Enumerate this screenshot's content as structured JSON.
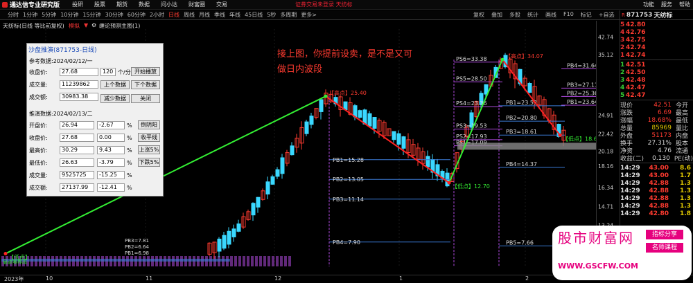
{
  "app": {
    "title": "通达信专业研究版",
    "menu": [
      "投研",
      "股票",
      "期货",
      "数据",
      "问小达",
      "财富圈",
      "交易"
    ],
    "login_notice": "证券交易未登录",
    "login_extra": "天纺标",
    "right_menu": [
      "功能",
      "服务",
      "帮助"
    ],
    "brand_color": "#d22222"
  },
  "period_bar": {
    "periods": [
      "分时",
      "1分钟",
      "5分钟",
      "10分钟",
      "15分钟",
      "30分钟",
      "60分钟",
      "2小时",
      "日线",
      "周线",
      "月线",
      "季线",
      "年线",
      "45日线",
      "5秒",
      "多周期",
      "更多>"
    ],
    "active": "日线",
    "tools": [
      "复权",
      "叠加",
      "多股",
      "统计",
      "画线",
      "F10",
      "标记",
      "+自选",
      "返回"
    ]
  },
  "indicator": {
    "title": "天纺标(日线 等比前复权)",
    "mode": "模拟",
    "formula": "缠论预测主图(1)"
  },
  "dialog": {
    "title": "沙盘推演(871753-日线)",
    "ref_section": "参考数据:2024/02/12/一",
    "ref": [
      {
        "label": "收盘价:",
        "value": "27.68"
      },
      {
        "label": "成交量:",
        "value": "11239862"
      },
      {
        "label": "成交额:",
        "value": "30983.38"
      }
    ],
    "minutes_value": "120",
    "minutes_unit": "个/分",
    "buttons": {
      "start": "开始播放",
      "prev": "上个数据",
      "next": "下个数据",
      "reduce": "减少数据",
      "close": "关闭"
    },
    "push_section": "推演数据:2024/02/13/二",
    "push": [
      {
        "label": "开盘价:",
        "value": "26.94",
        "pct": "-2.67",
        "btn": "倒阴阳"
      },
      {
        "label": "收盘价:",
        "value": "27.68",
        "pct": "0.00",
        "btn": "收平线"
      },
      {
        "label": "最高价:",
        "value": "30.29",
        "pct": "9.43",
        "btn": "上涨5%"
      },
      {
        "label": "最低价:",
        "value": "26.63",
        "pct": "-3.79",
        "btn": "下跌5%"
      },
      {
        "label": "成交量:",
        "value": "9525725",
        "pct": "-15.25",
        "btn": ""
      },
      {
        "label": "成交额:",
        "value": "27137.99",
        "pct": "-12.41",
        "btn": ""
      }
    ],
    "pct_unit": "%"
  },
  "annotation": {
    "line1": "接上图，你提前设卖，是不是又可",
    "line2": "做日内波段"
  },
  "chart_data": {
    "type": "candlestick",
    "ylim": [
      6.5,
      43.5
    ],
    "yaxis_labels": [
      "42.74",
      "35.12",
      "24.91",
      "22.42",
      "20.18",
      "18.16",
      "16.34",
      "14.71",
      "13.24",
      "11.91",
      "10.72",
      "9.65",
      "8.68",
      "7.82"
    ],
    "date_labels": [
      "2023年",
      "10",
      "11",
      "12",
      "1",
      "2"
    ],
    "zigzag": [
      {
        "x": 8,
        "y": 7.2,
        "label": "【低点】"
      },
      {
        "x": 470,
        "y": 25.4,
        "label": "【高点】25.40"
      },
      {
        "x": 648,
        "y": 12.7,
        "label": "【低点】12.70"
      },
      {
        "x": 725,
        "y": 34.07,
        "label": "【高点】34.07"
      },
      {
        "x": 808,
        "y": 18.6,
        "label": "【低点】18.6"
      }
    ],
    "levels_left": [
      {
        "label": "PB1=15.28",
        "y": 15.28
      },
      {
        "label": "PB2=13.05",
        "y": 13.05
      },
      {
        "label": "PB3=11.14",
        "y": 11.14
      },
      {
        "label": "PB4=7.90",
        "y": 7.9
      }
    ],
    "levels_right": [
      {
        "label": "PS6=33.38",
        "y": 33.38
      },
      {
        "label": "PS5=28.50",
        "y": 28.5
      },
      {
        "label": "PS4=23.36",
        "y": 23.36
      },
      {
        "label": "PB1=23.53",
        "y": 23.53
      },
      {
        "label": "PB2=20.80",
        "y": 20.8
      },
      {
        "label": "PS3=19.53",
        "y": 19.53
      },
      {
        "label": "PS2=17.93",
        "y": 17.93
      },
      {
        "label": "PS1=17.09",
        "y": 17.09
      },
      {
        "label": "PB3=18.61",
        "y": 18.61
      },
      {
        "label": "PB4=14.37",
        "y": 14.37
      },
      {
        "label": "PB5=7.66",
        "y": 7.66
      }
    ],
    "levels_far": [
      {
        "label": "PB4=31.64",
        "y": 31.64
      },
      {
        "label": "PB3=27.11",
        "y": 27.11
      },
      {
        "label": "PB2=25.36",
        "y": 25.36
      },
      {
        "label": "PB1=23.64",
        "y": 23.64
      }
    ],
    "bottom_labels": [
      "PB3=7.81",
      "PB2=6.64",
      "PB1=6.98"
    ],
    "corner_label": "局点零界高",
    "colors": {
      "up": "#ff3b30",
      "down": "#3ad8ff",
      "upline": "#33ee33",
      "downline": "#ff2222",
      "level": "#3a7bd5",
      "purple": "#b04adf"
    }
  },
  "quote": {
    "code": "871753",
    "name": "天纺标",
    "asks": [
      {
        "lab": "5",
        "price": "42.80"
      },
      {
        "lab": "4",
        "price": "42.76"
      },
      {
        "lab": "3",
        "price": "42.75"
      },
      {
        "lab": "2",
        "price": "42.74"
      },
      {
        "lab": "1",
        "price": "42.74"
      }
    ],
    "bids": [
      {
        "lab": "1",
        "price": "42.51"
      },
      {
        "lab": "2",
        "price": "42.50"
      },
      {
        "lab": "3",
        "price": "42.48"
      },
      {
        "lab": "4",
        "price": "42.47"
      },
      {
        "lab": "5",
        "price": "42.47"
      }
    ],
    "stats": [
      {
        "k": "现价",
        "v": "42.51",
        "k2": "今开",
        "color": "#ff3b30"
      },
      {
        "k": "涨跌",
        "v": "6.69",
        "k2": "最高",
        "color": "#ff3b30"
      },
      {
        "k": "涨幅",
        "v": "18.68%",
        "k2": "最低",
        "color": "#ff3b30"
      },
      {
        "k": "总量",
        "v": "85969",
        "k2": "量比",
        "color": "#e2c900"
      },
      {
        "k": "外盘",
        "v": "51173",
        "k2": "内盘",
        "color": "#ff3b30"
      },
      {
        "k": "换手",
        "v": "27.31%",
        "k2": "股本",
        "color": "#ddd"
      },
      {
        "k": "净资",
        "v": "4.76",
        "k2": "流通",
        "color": "#ddd"
      },
      {
        "k": "收益(二)",
        "v": "0.130",
        "k2": "PE(动)",
        "color": "#ddd"
      }
    ],
    "ticks": [
      {
        "t": "14:29",
        "p": "43.00",
        "q": "8.6"
      },
      {
        "t": "14:29",
        "p": "43.00",
        "q": "1.7"
      },
      {
        "t": "14:29",
        "p": "42.88",
        "q": "1.3"
      },
      {
        "t": "14:29",
        "p": "42.88",
        "q": "1.3"
      },
      {
        "t": "14:29",
        "p": "42.88",
        "q": "1.3"
      },
      {
        "t": "14:29",
        "p": "42.88",
        "q": "1.3"
      },
      {
        "t": "14:29",
        "p": "42.80",
        "q": "1.8"
      }
    ]
  },
  "watermark": {
    "title": "股市财富网",
    "tag1": "指标分享",
    "tag2": "名师课程",
    "url": "WWW.GSCFW.COM"
  }
}
